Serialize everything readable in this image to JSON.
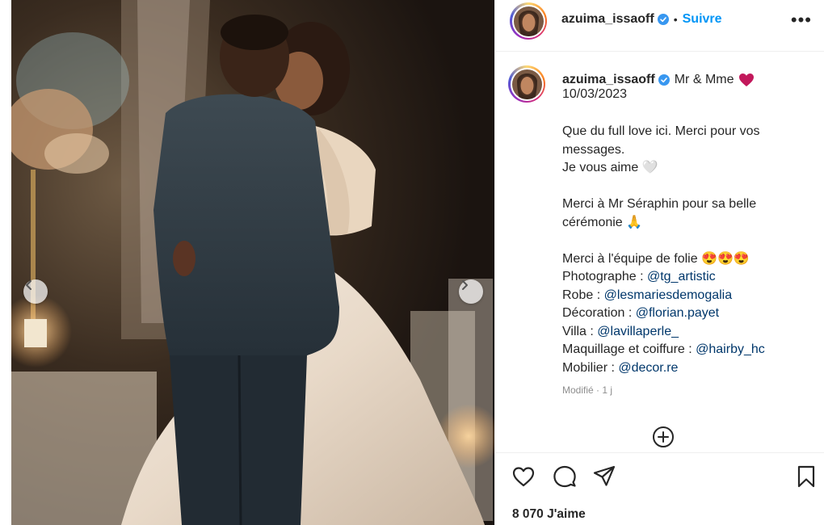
{
  "post": {
    "username": "azuima_issaoff",
    "follow_label": "Suivre",
    "separator": "•",
    "more_label": "•••"
  },
  "caption": {
    "headline": "Mr & Mme",
    "date": "10/03/2023",
    "line1": "Que du full love ici. Merci pour vos",
    "line2": "messages.",
    "line3": "Je vous aime 🤍",
    "line4": "Merci à Mr Séraphin pour sa belle",
    "line5": "cérémonie 🙏",
    "line6": "Merci à l'équipe de folie 😍😍😍",
    "credits": [
      {
        "label": "Photographe : ",
        "handle": "@tg_artistic"
      },
      {
        "label": "Robe : ",
        "handle": "@lesmariesdemogalia"
      },
      {
        "label": "Décoration : ",
        "handle": "@florian.payet"
      },
      {
        "label": "Villa : ",
        "handle": "@lavillaperle_"
      },
      {
        "label": "Maquillage et coiffure : ",
        "handle": "@hairby_hc"
      },
      {
        "label": "Mobilier : ",
        "handle": "@decor.re"
      }
    ],
    "edited": "Modifié · 1 j"
  },
  "likes": "8 070 J'aime",
  "colors": {
    "accent": "#0095f6",
    "mention": "#00376b",
    "verified": "#3897f0",
    "heart_emoji": "#c2185b"
  },
  "icons": [
    "verified-badge-icon",
    "red-heart-icon",
    "add-circle-icon",
    "like-heart-icon",
    "comment-icon",
    "share-icon",
    "save-bookmark-icon",
    "chevron-left-icon",
    "chevron-right-icon"
  ]
}
